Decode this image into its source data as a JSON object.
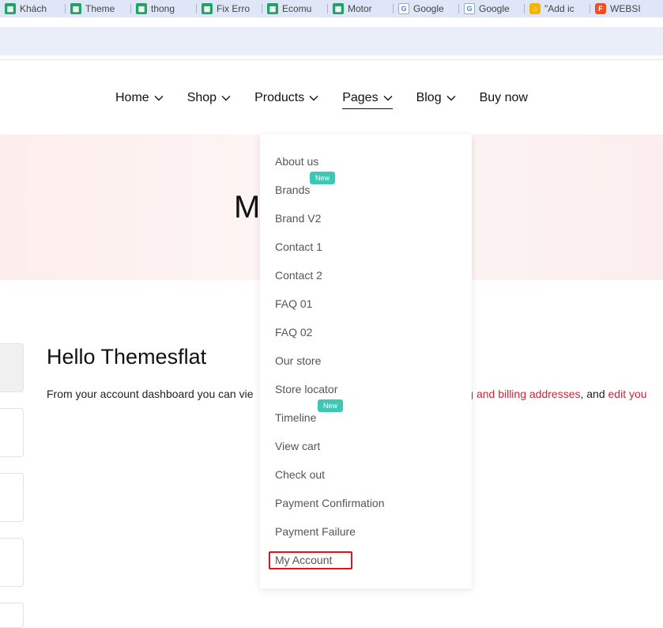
{
  "bookmarks": [
    {
      "label": "Khách",
      "icon": "sheets-icon"
    },
    {
      "label": "Theme",
      "icon": "sheets-icon"
    },
    {
      "label": "thong",
      "icon": "sheets-icon"
    },
    {
      "label": "Fix Erro",
      "icon": "sheets-icon"
    },
    {
      "label": "Ecomu",
      "icon": "sheets-icon"
    },
    {
      "label": "Motor",
      "icon": "sheets-icon"
    },
    {
      "label": "Google",
      "icon": "google-translate-icon"
    },
    {
      "label": "Google",
      "icon": "google-translate-icon"
    },
    {
      "label": "\"Add ic",
      "icon": "home-icon"
    },
    {
      "label": "WEBSI",
      "icon": "figma-icon"
    }
  ],
  "nav": {
    "items": [
      "Home",
      "Shop",
      "Products",
      "Pages",
      "Blog",
      "Buy now"
    ],
    "active": "Pages"
  },
  "hero": {
    "title_visible": "M"
  },
  "account": {
    "greeting": "Hello Themesflat",
    "dashboard_text_start": "From your account dashboard you can vie",
    "dashboard_link1": "ng and billing addresses",
    "dashboard_text_mid": ", and ",
    "dashboard_link2": "edit you"
  },
  "dropdown": {
    "items": [
      "About us",
      "Brands",
      "Brand V2",
      "Contact 1",
      "Contact 2",
      "FAQ 01",
      "FAQ 02",
      "Our store",
      "Store locator",
      "Timeline",
      "View cart",
      "Check out",
      "Payment Confirmation",
      "Payment Failure",
      "My Account"
    ],
    "badge_text": "New",
    "badged_items": [
      "Brands",
      "Timeline"
    ],
    "highlighted_item": "My Account"
  },
  "colors": {
    "badge": "#3cc8b4",
    "link": "#d0263a",
    "highlight_border": "#e0121b",
    "hero_bg": "#fdeeed"
  }
}
